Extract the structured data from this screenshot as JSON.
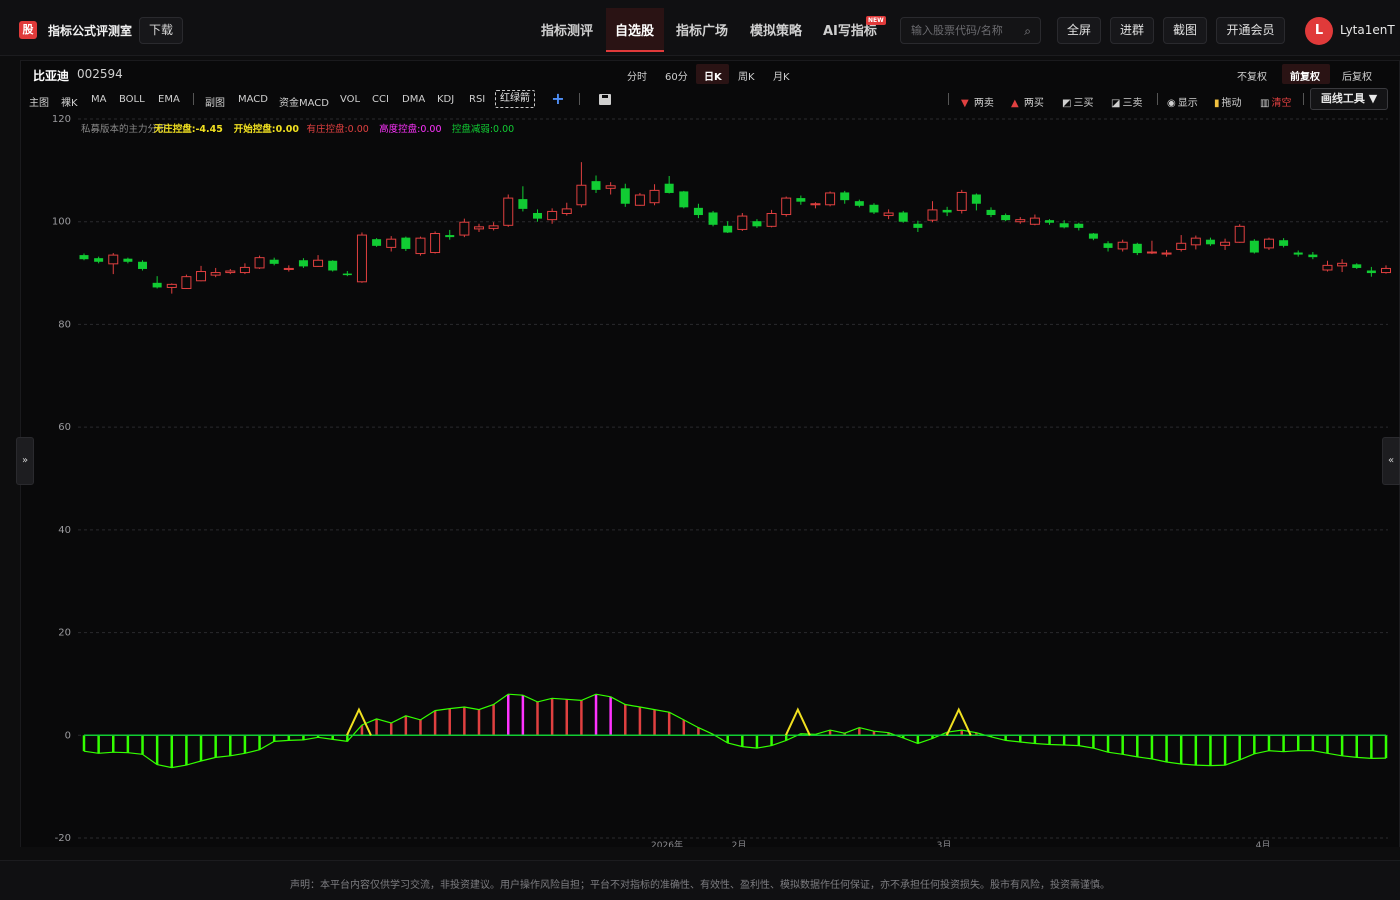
{
  "header": {
    "logo_char": "股",
    "app_title": "指标公式评测室",
    "download": "下载",
    "nav": [
      "指标测评",
      "自选股",
      "指标广场",
      "模拟策略",
      "AI写指标"
    ],
    "new_badge": "NEW",
    "search_placeholder": "输入股票代码/名称",
    "buttons": [
      "全屏",
      "进群",
      "截图",
      "开通会员"
    ],
    "avatar_letter": "L",
    "username": "Lyta1enT"
  },
  "stock": {
    "name": "比亚迪",
    "code": "002594"
  },
  "periods": [
    "分时",
    "60分",
    "日K",
    "周K",
    "月K"
  ],
  "active_period": "日K",
  "adjust": [
    "不复权",
    "前复权",
    "后复权"
  ],
  "active_adjust": "前复权",
  "indicators_main": [
    "主图",
    "裸K",
    "MA",
    "BOLL",
    "EMA"
  ],
  "indicators_sub": [
    "副图",
    "MACD",
    "资金MACD",
    "VOL",
    "CCI",
    "DMA",
    "KDJ",
    "RSI"
  ],
  "indicator_selected": "红绿箭",
  "tools": {
    "two_sell": "两卖",
    "two_buy": "两买",
    "three_buy": "三买",
    "three_sell": "三卖",
    "show": "显示",
    "drag": "拖动",
    "clear": "清空",
    "draw_tools": "画线工具"
  },
  "side_left": "»",
  "side_right": "«",
  "colors": {
    "up": "#e04040",
    "down": "#11cc33",
    "accent": "#e03a3a",
    "yellow": "#f0e020",
    "magenta": "#ff33ff",
    "green_line": "#33ff00"
  },
  "chart_data": {
    "type": "candlestick",
    "ylim": [
      -20,
      120
    ],
    "y_ticks": [
      "120",
      "100",
      "80",
      "60",
      "40",
      "20",
      "0",
      "-20"
    ],
    "x_ticks": [
      "2026年",
      "2月",
      "3月",
      "4月"
    ],
    "legend": [
      {
        "label": "私募版本的主力分析",
        "value": "",
        "color": "#888888"
      },
      {
        "label": "无庄控盘:",
        "value": "-4.45",
        "color": "#f0e020"
      },
      {
        "label": "开始控盘:",
        "value": "0.00",
        "color": "#f0e020"
      },
      {
        "label": "有庄控盘:",
        "value": "0.00",
        "color": "#e04040"
      },
      {
        "label": "高度控盘:",
        "value": "0.00",
        "color": "#ff33ff"
      },
      {
        "label": "控盘减弱:",
        "value": "0.00",
        "color": "#11cc33"
      }
    ],
    "candles": [
      [
        93.5,
        92.7,
        93.8,
        92.5
      ],
      [
        92.9,
        92.2,
        93.2,
        91.9
      ],
      [
        91.8,
        93.5,
        93.9,
        89.8
      ],
      [
        92.8,
        92.2,
        93.0,
        91.9
      ],
      [
        92.2,
        90.8,
        92.5,
        90.5
      ],
      [
        88.1,
        87.2,
        89.4,
        87.0
      ],
      [
        87.2,
        87.8,
        88.0,
        86.0
      ],
      [
        87.0,
        89.3,
        89.7,
        86.9
      ],
      [
        88.5,
        90.3,
        91.4,
        88.4
      ],
      [
        89.6,
        90.1,
        91.0,
        89.2
      ],
      [
        90.1,
        90.4,
        90.8,
        89.8
      ],
      [
        90.1,
        91.1,
        91.9,
        89.8
      ],
      [
        91.0,
        93.0,
        93.4,
        90.8
      ],
      [
        92.6,
        91.8,
        93.0,
        91.5
      ],
      [
        90.7,
        90.9,
        91.5,
        90.3
      ],
      [
        92.5,
        91.3,
        92.9,
        91.0
      ],
      [
        91.3,
        92.5,
        93.5,
        91.2
      ],
      [
        92.4,
        90.5,
        92.5,
        90.3
      ],
      [
        89.9,
        89.6,
        90.4,
        89.4
      ],
      [
        88.3,
        97.4,
        97.9,
        88.1
      ],
      [
        96.6,
        95.3,
        96.8,
        95.1
      ],
      [
        95.0,
        96.6,
        97.2,
        94.2
      ],
      [
        96.9,
        94.7,
        97.1,
        94.3
      ],
      [
        93.8,
        96.8,
        97.1,
        93.4
      ],
      [
        94.0,
        97.7,
        98.1,
        93.8
      ],
      [
        97.4,
        97.0,
        98.4,
        96.5
      ],
      [
        97.4,
        99.9,
        100.6,
        97.0
      ],
      [
        98.6,
        99.0,
        99.6,
        98.0
      ],
      [
        98.7,
        99.2,
        99.9,
        98.3
      ],
      [
        99.3,
        104.6,
        105.3,
        99.0
      ],
      [
        104.4,
        102.5,
        106.9,
        102.0
      ],
      [
        101.7,
        100.6,
        102.4,
        100.0
      ],
      [
        100.4,
        102.0,
        102.6,
        99.6
      ],
      [
        101.6,
        102.5,
        103.7,
        101.2
      ],
      [
        103.3,
        107.1,
        111.6,
        102.8
      ],
      [
        107.9,
        106.2,
        109.0,
        105.6
      ],
      [
        106.5,
        107.0,
        107.7,
        105.3
      ],
      [
        106.5,
        103.5,
        107.4,
        102.9
      ],
      [
        103.2,
        105.2,
        105.6,
        103.1
      ],
      [
        103.7,
        106.1,
        107.3,
        103.2
      ],
      [
        107.4,
        105.6,
        108.9,
        105.5
      ],
      [
        105.9,
        102.8,
        106.0,
        102.6
      ],
      [
        102.7,
        101.3,
        103.5,
        100.7
      ],
      [
        101.8,
        99.4,
        102.1,
        99.1
      ],
      [
        99.2,
        97.9,
        100.1,
        97.8
      ],
      [
        98.5,
        101.1,
        101.7,
        98.2
      ],
      [
        100.1,
        99.1,
        100.5,
        98.8
      ],
      [
        99.1,
        101.6,
        102.3,
        98.9
      ],
      [
        101.4,
        104.6,
        104.9,
        101.0
      ],
      [
        104.6,
        103.9,
        105.1,
        103.3
      ],
      [
        103.3,
        103.5,
        103.8,
        102.6
      ],
      [
        103.3,
        105.6,
        105.9,
        103.0
      ],
      [
        105.7,
        104.2,
        106.0,
        103.5
      ],
      [
        104.0,
        103.1,
        104.3,
        102.8
      ],
      [
        103.3,
        101.8,
        103.6,
        101.5
      ],
      [
        101.2,
        101.7,
        102.4,
        100.5
      ],
      [
        101.8,
        100.0,
        102.1,
        99.8
      ],
      [
        99.6,
        98.8,
        100.2,
        98.0
      ],
      [
        100.3,
        102.3,
        104.0,
        99.9
      ],
      [
        102.3,
        101.8,
        102.9,
        101.1
      ],
      [
        102.2,
        105.7,
        106.2,
        101.6
      ],
      [
        105.3,
        103.5,
        105.5,
        102.2
      ],
      [
        102.3,
        101.3,
        102.8,
        100.9
      ],
      [
        101.3,
        100.3,
        101.6,
        100.1
      ],
      [
        100.0,
        100.4,
        100.9,
        99.6
      ],
      [
        99.5,
        100.7,
        101.4,
        99.3
      ],
      [
        100.3,
        99.8,
        100.5,
        99.4
      ],
      [
        99.7,
        98.9,
        100.3,
        98.7
      ],
      [
        99.6,
        98.8,
        99.8,
        98.3
      ],
      [
        97.7,
        96.7,
        97.8,
        96.4
      ],
      [
        95.8,
        94.9,
        96.2,
        94.2
      ],
      [
        94.7,
        96.0,
        96.5,
        94.2
      ],
      [
        95.7,
        93.9,
        95.9,
        93.5
      ],
      [
        94.0,
        94.1,
        96.3,
        93.7
      ],
      [
        93.7,
        93.9,
        94.5,
        93.2
      ],
      [
        94.6,
        95.8,
        97.4,
        94.2
      ],
      [
        95.5,
        96.8,
        97.3,
        94.6
      ],
      [
        96.5,
        95.6,
        96.9,
        95.3
      ],
      [
        95.4,
        96.0,
        96.7,
        94.5
      ],
      [
        96.0,
        99.1,
        99.5,
        95.9
      ],
      [
        96.3,
        94.0,
        96.6,
        93.8
      ],
      [
        94.9,
        96.6,
        96.9,
        94.5
      ],
      [
        96.4,
        95.3,
        96.8,
        95.0
      ],
      [
        94.0,
        93.6,
        94.4,
        93.2
      ],
      [
        93.6,
        93.1,
        94.1,
        92.7
      ],
      [
        90.6,
        91.5,
        92.4,
        90.3
      ],
      [
        91.4,
        91.9,
        92.7,
        90.2
      ],
      [
        91.7,
        91.0,
        91.9,
        90.8
      ],
      [
        90.5,
        90.0,
        91.2,
        89.3
      ],
      [
        90.1,
        90.9,
        91.5,
        89.9
      ]
    ],
    "sub_indicator": [
      -3.1,
      -3.5,
      -3.3,
      -3.4,
      -3.7,
      -5.7,
      -6.3,
      -5.8,
      -5.0,
      -4.3,
      -4.0,
      -3.5,
      -2.8,
      -1.2,
      -1.0,
      -0.9,
      -0.4,
      -0.8,
      -1.2,
      2.0,
      3.2,
      2.4,
      3.8,
      3.0,
      4.8,
      5.2,
      5.5,
      5.0,
      6.0,
      8.0,
      7.8,
      6.5,
      7.2,
      7.0,
      6.8,
      8.0,
      7.5,
      6.0,
      5.5,
      5.0,
      4.5,
      3.0,
      1.5,
      0.2,
      -1.5,
      -2.2,
      -2.5,
      -2.0,
      -1.0,
      0.3,
      0.2,
      1.0,
      0.4,
      1.5,
      0.8,
      0.5,
      -0.5,
      -1.6,
      -0.6,
      0.6,
      1.0,
      0.5,
      -0.3,
      -1.0,
      -1.3,
      -1.6,
      -1.8,
      -1.9,
      -2.0,
      -2.5,
      -3.3,
      -3.7,
      -4.2,
      -4.6,
      -5.2,
      -5.6,
      -5.8,
      -5.9,
      -5.8,
      -4.8,
      -3.6,
      -3.0,
      -3.2,
      -3.0,
      -3.0,
      -3.5,
      -4.0,
      -4.3,
      -4.5,
      -4.45
    ],
    "triangles": [
      19,
      49,
      60
    ]
  },
  "footer": "声明：本平台内容仅供学习交流，非投资建议。用户操作风险自担；平台不对指标的准确性、有效性、盈利性、模拟数据作任何保证，亦不承担任何投资损失。股市有风险，投资需谨慎。"
}
